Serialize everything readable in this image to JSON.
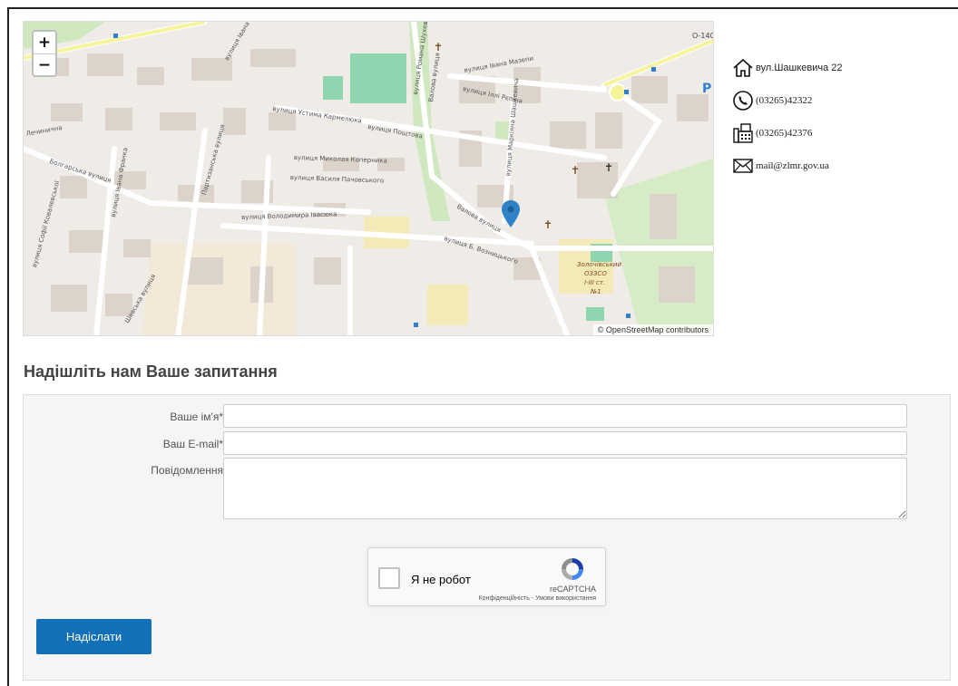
{
  "map": {
    "zoom_in_label": "+",
    "zoom_out_label": "−",
    "attribution": "© OpenStreetMap contributors",
    "road_sign": "O-140",
    "streets": [
      "вулиця Устима Кармелюка",
      "вулиця Миколая Коперника",
      "вулиця Василя Пачовського",
      "вулиця Володимира Івасюка",
      "вулиця Пощтова",
      "вулиця Івана Мазепи",
      "вулиця Іллі Рєпіна",
      "вулиця Івана Франка",
      "вулиця Романа Шухевича",
      "Валова вулиця",
      "Болгарська вулиця",
      "вулиця Б. Возницького",
      "Партизанська вулиця",
      "Лечинична",
      "вулиця Софії Ковалевської",
      "вулиця Івана Франка",
      "Валова вулиця",
      "вулиця Маркіяна Шашкевича",
      "Шевська вулиця"
    ],
    "poi_label": "Золочівський ОЗЗСО І-ІІІ ст. №1"
  },
  "contacts": {
    "address": "вул.Шашкевича 22",
    "phone": "(03265)42322",
    "fax": "(03265)42376",
    "email": "mail@zlmr.gov.ua"
  },
  "form": {
    "title": "Надішліть нам Ваше запитання",
    "name_label": "Ваше ім'я*",
    "name_value": "",
    "email_label": "Ваш E-mail*",
    "email_value": "",
    "message_label": "Повідомлення",
    "message_value": "",
    "captcha_label": "Я не робот",
    "captcha_brand": "reCAPTCHA",
    "captcha_terms": "Конфіденційність - Умови використання",
    "submit_label": "Надіслати"
  },
  "colors": {
    "button": "#1270b8",
    "marker": "#2f82c8"
  }
}
